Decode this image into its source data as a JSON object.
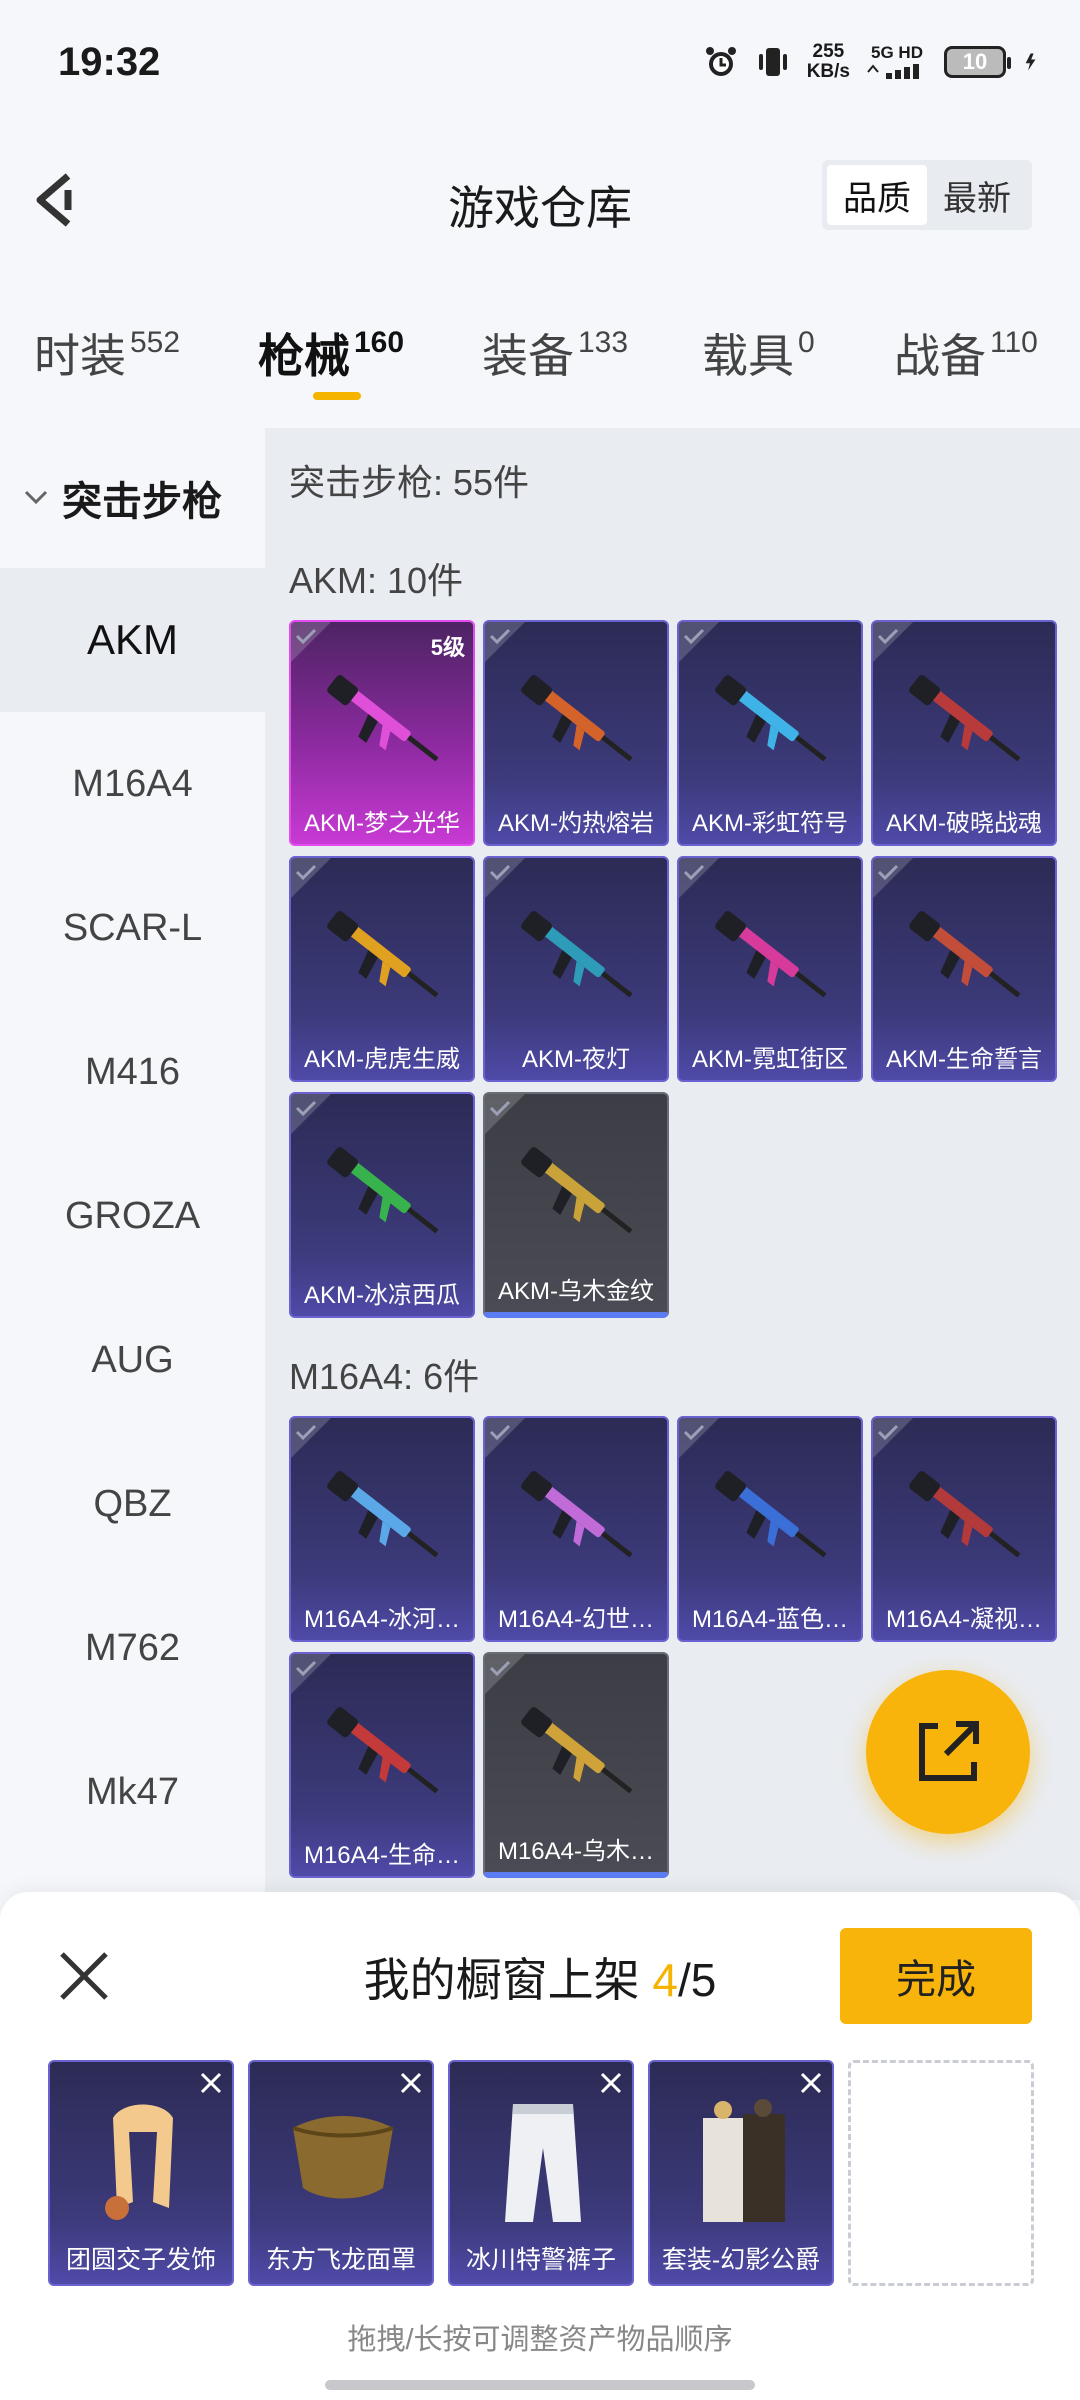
{
  "status_bar": {
    "time": "19:32",
    "speed_value": "255",
    "speed_unit": "KB/s",
    "network": "5G HD",
    "battery": "10"
  },
  "header": {
    "title": "游戏仓库",
    "sort_options": [
      "品质",
      "最新"
    ],
    "sort_selected": "品质"
  },
  "tabs": [
    {
      "label": "时装",
      "count": "552"
    },
    {
      "label": "枪械",
      "count": "160",
      "active": true
    },
    {
      "label": "装备",
      "count": "133"
    },
    {
      "label": "载具",
      "count": "0"
    },
    {
      "label": "战备",
      "count": "110"
    }
  ],
  "sidebar": {
    "group": "突击步枪",
    "items": [
      "AKM",
      "M16A4",
      "SCAR-L",
      "M416",
      "GROZA",
      "AUG",
      "QBZ",
      "M762",
      "Mk47"
    ],
    "selected": "AKM"
  },
  "content": {
    "category_summary": "突击步枪: 55件",
    "sections": [
      {
        "title": "AKM: 10件",
        "items": [
          {
            "name": "AKM-梦之光华",
            "rarity": "purple",
            "level": "5级"
          },
          {
            "name": "AKM-灼热熔岩",
            "rarity": "blue"
          },
          {
            "name": "AKM-彩虹符号",
            "rarity": "blue"
          },
          {
            "name": "AKM-破晓战魂",
            "rarity": "blue"
          },
          {
            "name": "AKM-虎虎生威",
            "rarity": "blue"
          },
          {
            "name": "AKM-夜灯",
            "rarity": "blue"
          },
          {
            "name": "AKM-霓虹街区",
            "rarity": "blue"
          },
          {
            "name": "AKM-生命誓言",
            "rarity": "blue"
          },
          {
            "name": "AKM-冰凉西瓜",
            "rarity": "blue"
          },
          {
            "name": "AKM-乌木金纹",
            "rarity": "grey"
          }
        ]
      },
      {
        "title": "M16A4: 6件",
        "items": [
          {
            "name": "M16A4-冰河…",
            "rarity": "blue"
          },
          {
            "name": "M16A4-幻世…",
            "rarity": "blue"
          },
          {
            "name": "M16A4-蓝色…",
            "rarity": "blue"
          },
          {
            "name": "M16A4-凝视…",
            "rarity": "blue"
          },
          {
            "name": "M16A4-生命…",
            "rarity": "blue"
          },
          {
            "name": "M16A4-乌木…",
            "rarity": "grey"
          }
        ]
      }
    ]
  },
  "showcase": {
    "title_prefix": "我的橱窗上架",
    "current": "4",
    "separator": "/",
    "max": "5",
    "done_label": "完成",
    "slots": [
      {
        "name": "团圆交子发饰"
      },
      {
        "name": "东方飞龙面罩"
      },
      {
        "name": "冰川特警裤子"
      },
      {
        "name": "套装-幻影公爵"
      }
    ],
    "hint": "拖拽/长按可调整资产物品顺序"
  },
  "colors": {
    "accent": "#f8b40a",
    "card_blue": "#4f4aa8",
    "card_purple": "#c83ad4",
    "card_grey": "#4a4b54"
  }
}
